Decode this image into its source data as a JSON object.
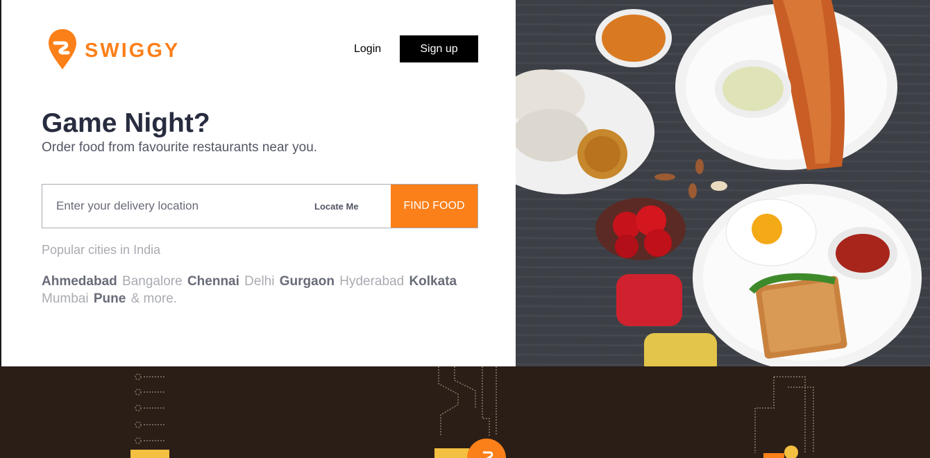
{
  "brand": {
    "name": "SWIGGY",
    "accent": "#fc8019"
  },
  "header": {
    "login_label": "Login",
    "signup_label": "Sign up"
  },
  "hero": {
    "title": "Game Night?",
    "subtitle": "Order food from favourite restaurants near you."
  },
  "search": {
    "placeholder": "Enter your delivery location",
    "value": "",
    "locate_label": "Locate Me",
    "submit_label": "FIND FOOD"
  },
  "popular": {
    "title": "Popular cities in India",
    "cities": [
      {
        "name": "Ahmedabad",
        "style": "bold"
      },
      {
        "name": "Bangalore",
        "style": "light"
      },
      {
        "name": "Chennai",
        "style": "bold"
      },
      {
        "name": "Delhi",
        "style": "light"
      },
      {
        "name": "Gurgaon",
        "style": "bold"
      },
      {
        "name": "Hyderabad",
        "style": "light"
      },
      {
        "name": "Kolkata",
        "style": "bold"
      },
      {
        "name": "Mumbai",
        "style": "light"
      },
      {
        "name": "Pune",
        "style": "bold"
      }
    ],
    "more_label": "& more."
  },
  "icons": [
    "swiggy-logo-icon"
  ]
}
